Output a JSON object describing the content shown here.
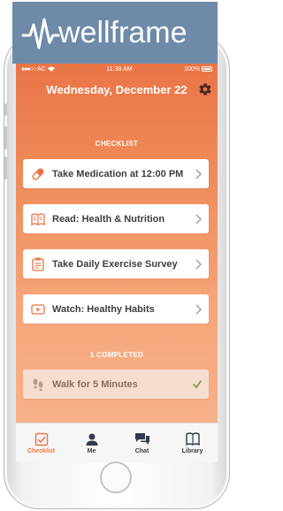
{
  "brand": {
    "logo_text": "wellframe"
  },
  "status_bar": {
    "carrier": "AC",
    "time": "11:38 AM",
    "battery": "100%"
  },
  "header": {
    "date": "Wednesday, December 22"
  },
  "checklist": {
    "title": "CHECKLIST",
    "items": [
      {
        "label": "Take Medication at 12:00 PM",
        "icon": "pill-icon"
      },
      {
        "label": "Read: Health & Nutrition",
        "icon": "book-icon"
      },
      {
        "label": "Take Daily Exercise Survey",
        "icon": "clipboard-icon"
      },
      {
        "label": "Watch: Healthy Habits",
        "icon": "video-icon"
      }
    ]
  },
  "completed": {
    "title": "1 COMPLETED",
    "items": [
      {
        "label": "Walk for 5 Minutes",
        "icon": "footsteps-icon",
        "done": true
      }
    ]
  },
  "tabbar": {
    "tabs": [
      {
        "label": "Checklist",
        "icon": "checkbox-icon",
        "active": true
      },
      {
        "label": "Me",
        "icon": "person-icon",
        "active": false
      },
      {
        "label": "Chat",
        "icon": "chat-icon",
        "active": false
      },
      {
        "label": "Library",
        "icon": "book-icon",
        "active": false
      }
    ]
  },
  "colors": {
    "accent": "#ea7446",
    "logo_bg": "#6f8aa8",
    "check_green": "#7a9a3a"
  }
}
